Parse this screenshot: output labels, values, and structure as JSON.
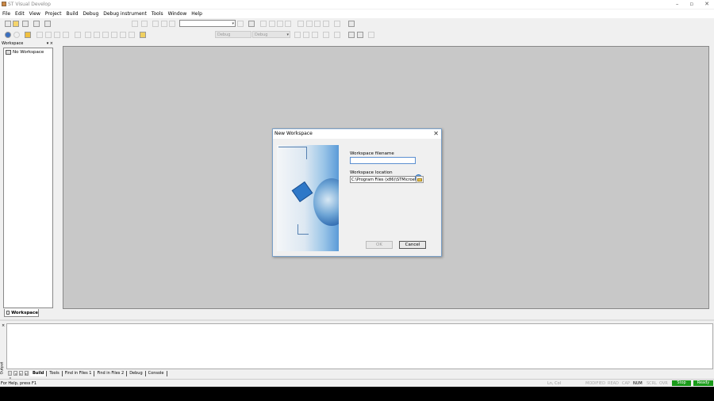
{
  "window": {
    "title": "ST Visual Develop",
    "minimize": "–",
    "maximize": "▫",
    "close": "✕"
  },
  "menu": [
    "File",
    "Edit",
    "View",
    "Project",
    "Build",
    "Debug",
    "Debug instrument",
    "Tools",
    "Window",
    "Help"
  ],
  "toolbar": {
    "combo1_value": "",
    "combo_debug_left": "Debug",
    "combo_debug_right": "Debug"
  },
  "workspace": {
    "title": "Workspace",
    "controls": "▾ ×",
    "tree_item": "No Workspace",
    "tab": "Workspace"
  },
  "output": {
    "label": "Output",
    "close": "×",
    "nav": [
      "|◂",
      "◂",
      "▸",
      "▸|"
    ],
    "tabs": [
      "Build",
      "Tools",
      "Find in Files 1",
      "Find in Files 2",
      "Debug",
      "Console"
    ]
  },
  "status": {
    "help": "For Help, press F1",
    "lncol": "Ln, Col",
    "indicators": [
      "MODIFIED",
      "READ",
      "CAP",
      "NUM",
      "SCRL",
      "OVR"
    ],
    "active_indicator": "NUM",
    "stop": "Stop",
    "ready": "Ready",
    "status_color": "#1a9a1a"
  },
  "dialog": {
    "title": "New Workspace",
    "close": "✕",
    "filename_label": "Workspace filename",
    "filename_value": "",
    "location_label": "Workspace location",
    "location_value": "C:\\Program Files (x86)\\STMicroelec",
    "ok": "OK",
    "cancel": "Cancel"
  }
}
